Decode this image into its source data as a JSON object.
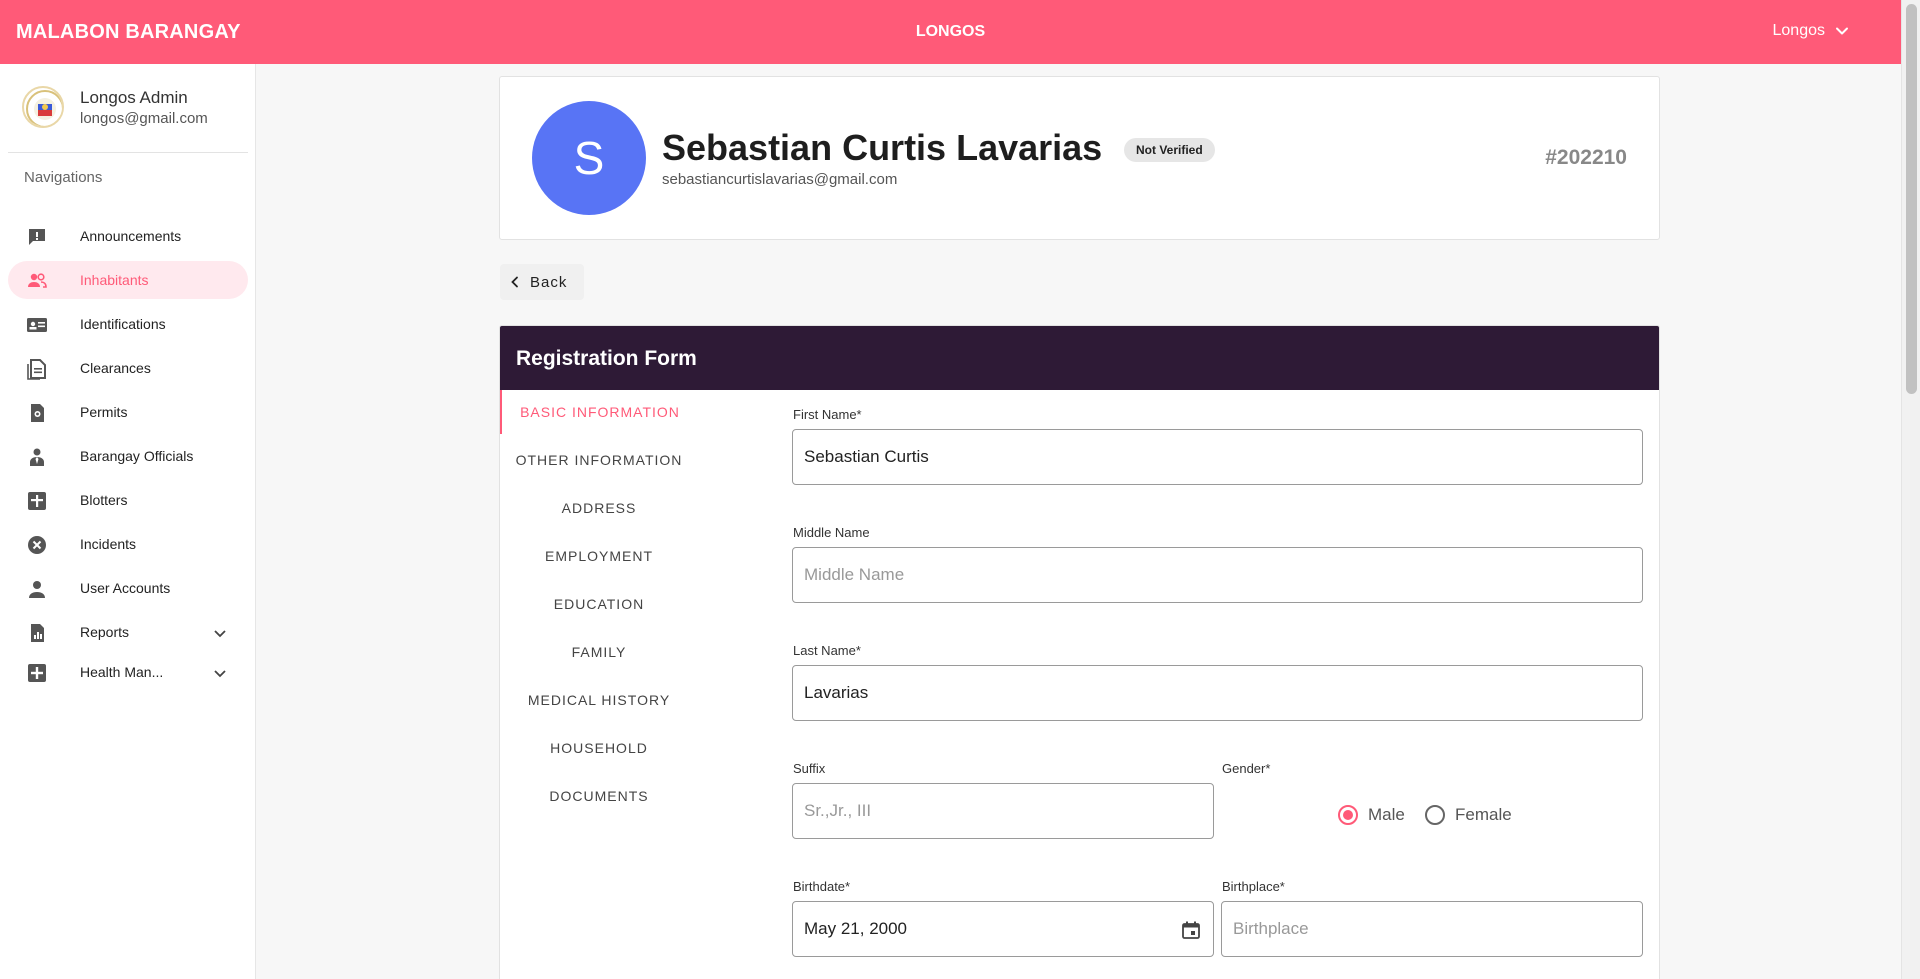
{
  "header": {
    "brand": "MALABON BARANGAY",
    "center_title": "LONGOS",
    "user_menu_label": "Longos"
  },
  "sidebar": {
    "profile": {
      "name": "Longos Admin",
      "email": "longos@gmail.com"
    },
    "heading": "Navigations",
    "items": [
      {
        "label": "Announcements",
        "icon": "announcement-icon",
        "active": false
      },
      {
        "label": "Inhabitants",
        "icon": "people-icon",
        "active": true
      },
      {
        "label": "Identifications",
        "icon": "id-card-icon",
        "active": false
      },
      {
        "label": "Clearances",
        "icon": "document-icon",
        "active": false
      },
      {
        "label": "Permits",
        "icon": "permit-icon",
        "active": false
      },
      {
        "label": "Barangay Officials",
        "icon": "official-icon",
        "active": false
      },
      {
        "label": "Blotters",
        "icon": "blotter-icon",
        "active": false
      },
      {
        "label": "Incidents",
        "icon": "incident-icon",
        "active": false
      },
      {
        "label": "User Accounts",
        "icon": "user-icon",
        "active": false
      },
      {
        "label": "Reports",
        "icon": "report-icon",
        "active": false
      },
      {
        "label": "Health Man...",
        "icon": "health-icon",
        "active": false
      }
    ]
  },
  "profile_card": {
    "initial": "S",
    "name": "Sebastian Curtis Lavarias",
    "badge": "Not Verified",
    "email": "sebastiancurtislavarias@gmail.com",
    "id": "#202210"
  },
  "back_label": "Back",
  "form": {
    "title": "Registration Form",
    "tabs": [
      "BASIC INFORMATION",
      "OTHER INFORMATION",
      "ADDRESS",
      "EMPLOYMENT",
      "EDUCATION",
      "FAMILY",
      "MEDICAL HISTORY",
      "HOUSEHOLD",
      "DOCUMENTS"
    ],
    "first_name": {
      "label": "First Name*",
      "value": "Sebastian Curtis"
    },
    "middle_name": {
      "label": "Middle Name",
      "placeholder": "Middle Name"
    },
    "last_name": {
      "label": "Last Name*",
      "value": "Lavarias"
    },
    "suffix": {
      "label": "Suffix",
      "placeholder": "Sr.,Jr., III"
    },
    "gender": {
      "label": "Gender*",
      "options": [
        "Male",
        "Female"
      ],
      "selected": "Male"
    },
    "birthdate": {
      "label": "Birthdate*",
      "value": "May 21, 2000"
    },
    "birthplace": {
      "label": "Birthplace*",
      "placeholder": "Birthplace"
    }
  },
  "colors": {
    "accent": "#ff5a78",
    "form_header": "#2e1a36",
    "avatar": "#5874f5"
  }
}
